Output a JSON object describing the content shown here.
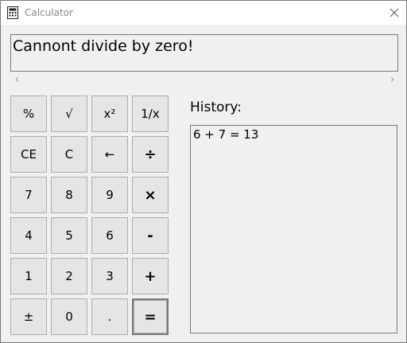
{
  "window": {
    "title": "Calculator",
    "icon": "calculator-icon"
  },
  "display": {
    "text": "Cannont divide by zero!"
  },
  "keys": [
    {
      "label": "%",
      "name": "percent-button"
    },
    {
      "label": "√",
      "name": "sqrt-button"
    },
    {
      "label": "x²",
      "name": "square-button"
    },
    {
      "label": "1/x",
      "name": "reciprocal-button"
    },
    {
      "label": "CE",
      "name": "clear-entry-button"
    },
    {
      "label": "C",
      "name": "clear-button"
    },
    {
      "label": "←",
      "name": "backspace-button"
    },
    {
      "label": "÷",
      "name": "divide-button"
    },
    {
      "label": "7",
      "name": "digit-7-button"
    },
    {
      "label": "8",
      "name": "digit-8-button"
    },
    {
      "label": "9",
      "name": "digit-9-button"
    },
    {
      "label": "×",
      "name": "multiply-button"
    },
    {
      "label": "4",
      "name": "digit-4-button"
    },
    {
      "label": "5",
      "name": "digit-5-button"
    },
    {
      "label": "6",
      "name": "digit-6-button"
    },
    {
      "label": "-",
      "name": "subtract-button"
    },
    {
      "label": "1",
      "name": "digit-1-button"
    },
    {
      "label": "2",
      "name": "digit-2-button"
    },
    {
      "label": "3",
      "name": "digit-3-button"
    },
    {
      "label": "+",
      "name": "add-button"
    },
    {
      "label": "±",
      "name": "negate-button"
    },
    {
      "label": "0",
      "name": "digit-0-button"
    },
    {
      "label": ".",
      "name": "decimal-button"
    },
    {
      "label": "=",
      "name": "equals-button"
    }
  ],
  "history": {
    "label": "History:",
    "entries": [
      "6 + 7 = 13"
    ]
  }
}
